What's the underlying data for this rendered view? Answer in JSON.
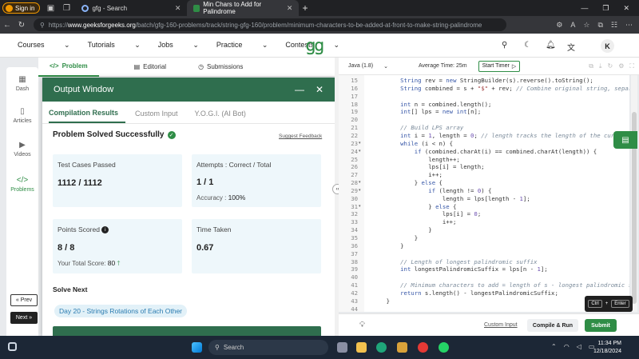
{
  "browser": {
    "profile_label": "Sign in",
    "tabs": [
      {
        "title": "gfg - Search"
      },
      {
        "title": "Min Chars to Add for Palindrome"
      }
    ],
    "url_prefix": "https://",
    "url_host": "www.geeksforgeeks.org",
    "url_path": "/batch/gfg-160-problems/track/string-gfg-160/problem/minimum-characters-to-be-added-at-front-to-make-string-palindrome"
  },
  "header": {
    "menu": [
      "Courses",
      "Tutorials",
      "Jobs",
      "Practice",
      "Contests"
    ],
    "user_initial": "K"
  },
  "problem_tabs": [
    "Problem",
    "Editorial",
    "Submissions"
  ],
  "rail": [
    {
      "label": "Dash"
    },
    {
      "label": "Articles"
    },
    {
      "label": "Videos"
    },
    {
      "label": "Problems"
    }
  ],
  "nav": {
    "prev": "« Prev",
    "next": "Next »"
  },
  "output": {
    "title": "Output Window",
    "tabs": [
      "Compilation Results",
      "Custom Input",
      "Y.O.G.I. (AI Bot)"
    ],
    "status": "Problem Solved Successfully",
    "feedback": "Suggest Feedback",
    "test_cases_label": "Test Cases Passed",
    "test_cases_value": "1112 / 1112",
    "attempts_label": "Attempts : Correct / Total",
    "attempts_value": "1 / 1",
    "accuracy_label": "Accuracy :",
    "accuracy_value": "100%",
    "points_label": "Points Scored",
    "points_value": "8 / 8",
    "total_score_label": "Your Total Score:",
    "total_score_value": "80",
    "time_label": "Time Taken",
    "time_value": "0.67",
    "solve_next": "Solve Next",
    "next_problem": "Day 20 - Strings Rotations of Each Other"
  },
  "editor": {
    "language": "Java (1.8)",
    "average_time": "Average Time: 25m",
    "timer_label": "Start Timer",
    "lines": [
      {
        "n": "15",
        "text": "        String rev = new StringBuilder(s).reverse().toString();"
      },
      {
        "n": "16",
        "text": "        String combined = s + \"$\" + rev; // Combine original string, separator,"
      },
      {
        "n": "17",
        "text": ""
      },
      {
        "n": "18",
        "text": "        int n = combined.length();"
      },
      {
        "n": "19",
        "text": "        int[] lps = new int[n];"
      },
      {
        "n": "20",
        "text": ""
      },
      {
        "n": "21",
        "text": "        // Build LPS array"
      },
      {
        "n": "22",
        "text": "        int i = 1, length = 0; // length tracks the length of the current"
      },
      {
        "n": "23",
        "text": "        while (i < n) {"
      },
      {
        "n": "24",
        "text": "            if (combined.charAt(i) == combined.charAt(length)) {"
      },
      {
        "n": "25",
        "text": "                length++;"
      },
      {
        "n": "26",
        "text": "                lps[i] = length;"
      },
      {
        "n": "27",
        "text": "                i++;"
      },
      {
        "n": "28",
        "text": "            } else {"
      },
      {
        "n": "29",
        "text": "                if (length != 0) {"
      },
      {
        "n": "30",
        "text": "                    length = lps[length - 1];"
      },
      {
        "n": "31",
        "text": "                } else {"
      },
      {
        "n": "32",
        "text": "                    lps[i] = 0;"
      },
      {
        "n": "33",
        "text": "                    i++;"
      },
      {
        "n": "34",
        "text": "                }"
      },
      {
        "n": "35",
        "text": "            }"
      },
      {
        "n": "36",
        "text": "        }"
      },
      {
        "n": "37",
        "text": ""
      },
      {
        "n": "38",
        "text": "        // Length of longest palindromic suffix"
      },
      {
        "n": "39",
        "text": "        int longestPalindromicSuffix = lps[n - 1];"
      },
      {
        "n": "40",
        "text": ""
      },
      {
        "n": "41",
        "text": "        // Minimum characters to add = length of s - longest palindromic suffix"
      },
      {
        "n": "42",
        "text": "        return s.length() - longestPalindromicSuffix;"
      },
      {
        "n": "43",
        "text": "    }"
      },
      {
        "n": "44",
        "text": ""
      }
    ],
    "custom_input": "Custom Input",
    "compile_run": "Compile & Run",
    "submit": "Submit",
    "shortcut_ctrl": "Ctrl",
    "shortcut_plus": "+",
    "shortcut_enter": "Enter"
  },
  "taskbar": {
    "search_label": "Search",
    "time": "11:34 PM",
    "date": "12/18/2024"
  },
  "colors": {
    "brand_green": "#2f8d46",
    "output_header": "#2f6e4e",
    "card_bg": "#eef7fb"
  }
}
